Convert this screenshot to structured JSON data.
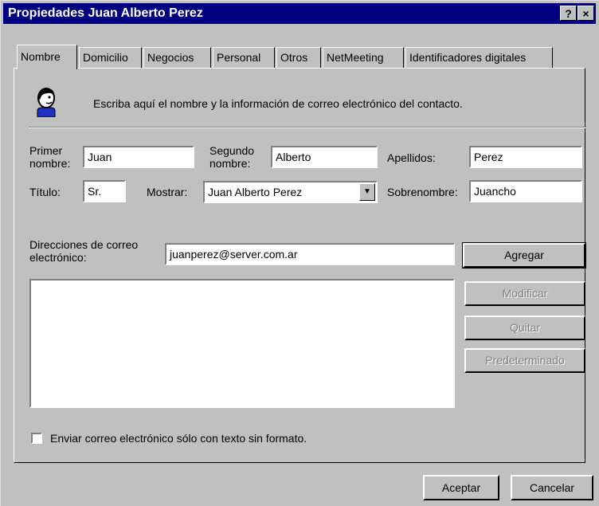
{
  "window": {
    "title": "Propiedades Juan Alberto Perez",
    "help_label": "?",
    "close_label": "×"
  },
  "tabs": [
    {
      "label": "Nombre",
      "active": true
    },
    {
      "label": "Domicilio"
    },
    {
      "label": "Negocios"
    },
    {
      "label": "Personal"
    },
    {
      "label": "Otros"
    },
    {
      "label": "NetMeeting"
    },
    {
      "label": "Identificadores digitales"
    }
  ],
  "header": {
    "description": "Escriba aquí el nombre y la información de correo electrónico del contacto."
  },
  "form": {
    "first_name": {
      "label": "Primer nombre:",
      "value": "Juan"
    },
    "middle_name": {
      "label": "Segundo nombre:",
      "value": "Alberto"
    },
    "last_name": {
      "label": "Apellidos:",
      "value": "Perez"
    },
    "title": {
      "label": "Título:",
      "value": "Sr."
    },
    "display": {
      "label": "Mostrar:",
      "value": "Juan Alberto Perez"
    },
    "nickname": {
      "label": "Sobrenombre:",
      "value": "Juancho"
    },
    "email": {
      "label": "Direcciones de correo electrónico:",
      "value": "juanperez@server.com.ar"
    }
  },
  "email_buttons": {
    "add": "Agregar",
    "edit": "Modificar",
    "remove": "Quitar",
    "default": "Predeterminado"
  },
  "plain_text_option": {
    "label": "Enviar correo electrónico sólo con texto sin formato.",
    "checked": false
  },
  "footer": {
    "ok": "Aceptar",
    "cancel": "Cancelar"
  }
}
